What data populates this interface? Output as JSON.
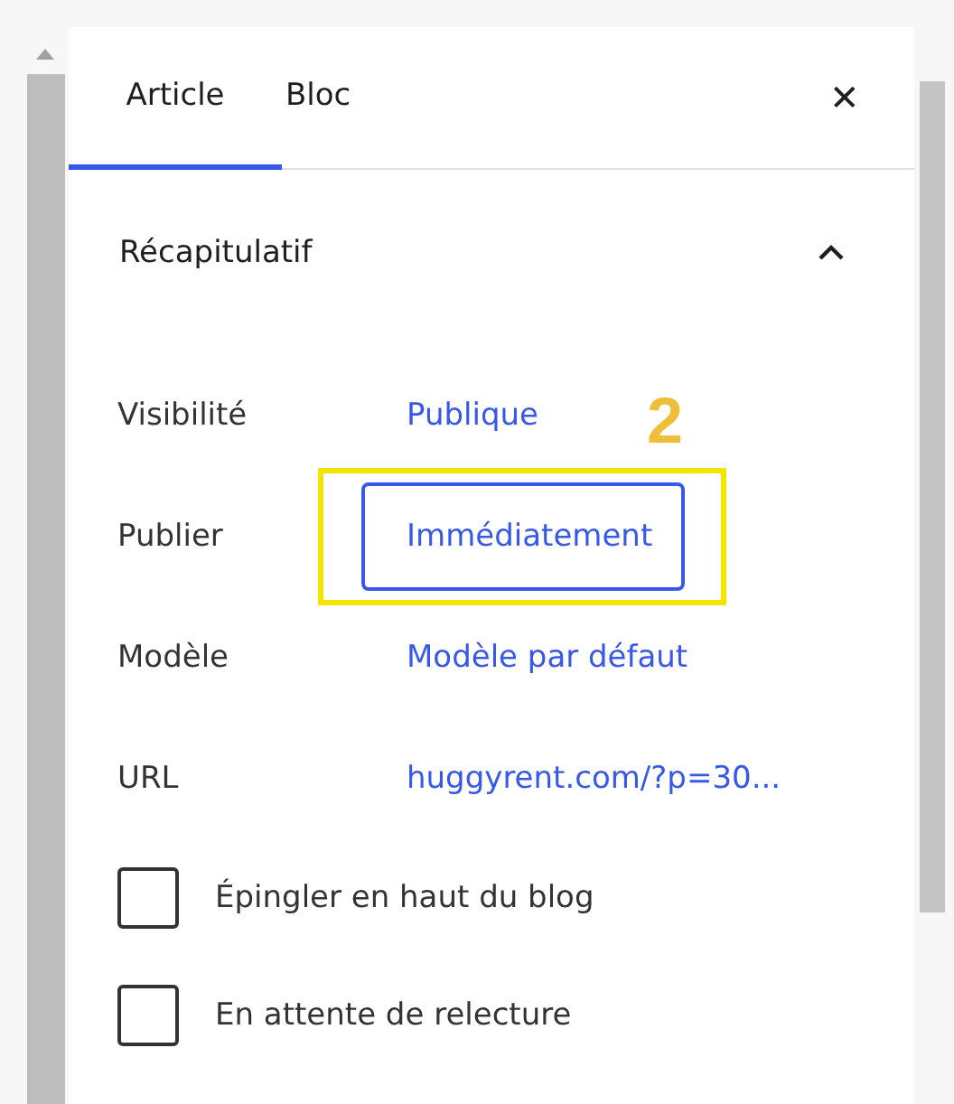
{
  "tabs": [
    {
      "label": "Article",
      "selected": true
    },
    {
      "label": "Bloc",
      "selected": false
    }
  ],
  "close_button": "✕",
  "section": {
    "title": "Récapitulatif",
    "expanded": true
  },
  "rows": [
    {
      "label": "Visibilité",
      "value": "Publique",
      "kind": "link"
    },
    {
      "label": "Publier",
      "value": "Immédiatement",
      "kind": "button",
      "annotation": "2"
    },
    {
      "label": "Modèle",
      "value": "Modèle par défaut",
      "kind": "link"
    },
    {
      "label": "URL",
      "value": "huggyrent.com/?p=30...",
      "kind": "link"
    }
  ],
  "checkboxes": [
    {
      "label": "Épingler en haut du blog",
      "checked": false
    },
    {
      "label": "En attente de relecture",
      "checked": false
    }
  ]
}
